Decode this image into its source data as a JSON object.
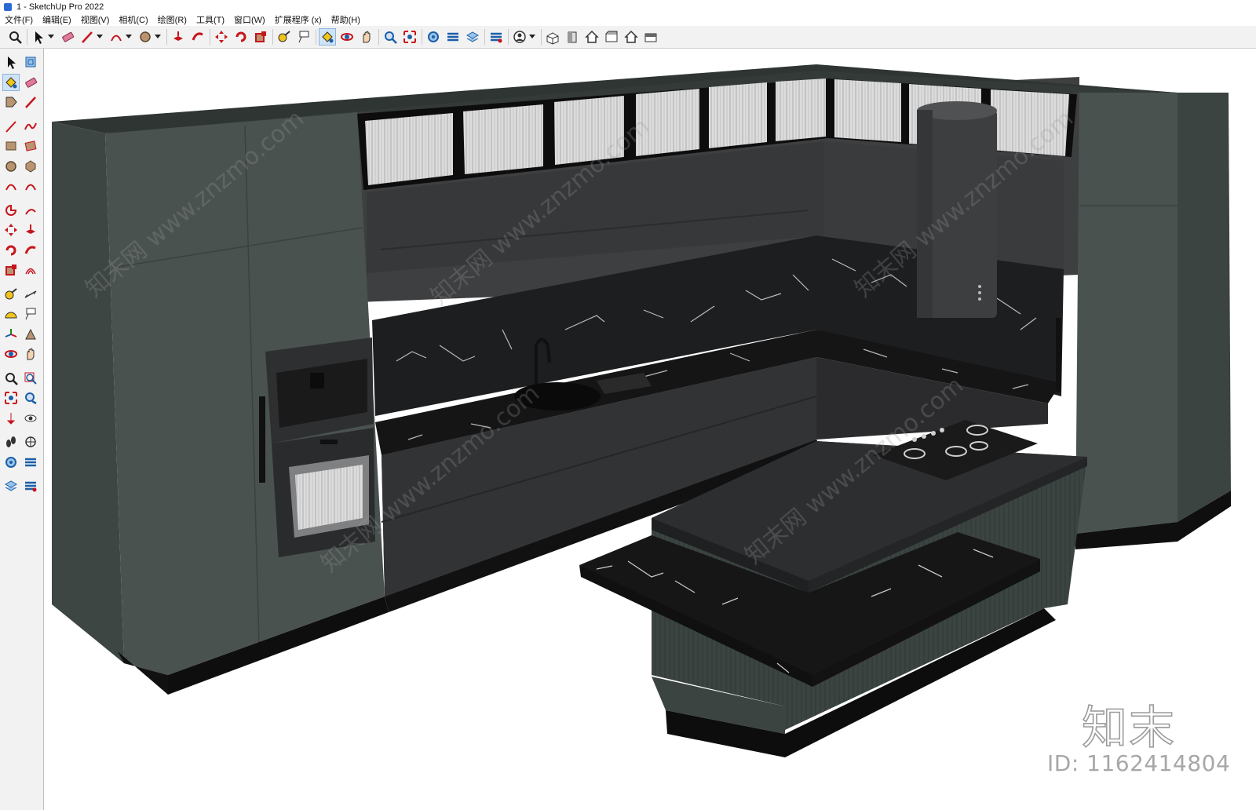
{
  "window": {
    "title": "1 - SketchUp Pro 2022"
  },
  "menu": [
    "文件(F)",
    "编辑(E)",
    "视图(V)",
    "相机(C)",
    "绘图(R)",
    "工具(T)",
    "窗口(W)",
    "扩展程序 (x)",
    "帮助(H)"
  ],
  "toolbar": {
    "icons": [
      "zoom-icon",
      "select-icon",
      "dropdown-arrow-icon",
      "eraser-icon",
      "pencil-line-icon",
      "dropdown-arrow-icon",
      "arc-icon",
      "dropdown-arrow-icon",
      "circle-icon",
      "dropdown-arrow-icon",
      "push-pull-icon",
      "follow-me-icon",
      "move-icon",
      "rotate-icon",
      "scale-icon",
      "tape-measure-icon",
      "text-label-icon",
      "paint-bucket-icon",
      "orbit-icon",
      "pan-icon",
      "zoom-tool-icon",
      "zoom-extents-icon",
      "outliner-icon",
      "tags-icon",
      "layers-icon",
      "styles-icon",
      "profile-icon",
      "dropdown-arrow-icon",
      "iso-view-icon",
      "front-view-icon",
      "home-view-icon",
      "right-view-icon",
      "back-view-icon",
      "left-view-icon"
    ],
    "active": "paint-bucket-icon"
  },
  "left_toolbar": {
    "icons": [
      "select-icon",
      "make-component-icon",
      "paint-bucket-icon",
      "eraser-icon",
      "tag-tool-icon",
      "pencil-icon",
      "line-icon",
      "freehand-icon",
      "rectangle-icon",
      "rotated-rectangle-icon",
      "circle-icon",
      "polygon-icon",
      "arc-icon",
      "two-point-arc-icon",
      "pie-icon",
      "three-point-arc-icon",
      "move-icon",
      "push-pull-icon",
      "rotate-icon",
      "follow-me-icon",
      "scale-icon",
      "offset-icon",
      "tape-measure-icon",
      "dimension-icon",
      "protractor-icon",
      "text-icon",
      "axes-icon",
      "3d-text-icon",
      "orbit-icon",
      "pan-icon",
      "zoom-icon",
      "zoom-window-icon",
      "zoom-extents-icon",
      "previous-view-icon",
      "position-camera-icon",
      "look-around-icon",
      "walk-icon",
      "section-plane-icon",
      "outliner-icon",
      "tags-icon",
      "layers-icon",
      "styles-icon"
    ],
    "active": "paint-bucket-icon"
  },
  "viewport": {
    "model": "kitchen-model",
    "wall_color": "#4a524f",
    "cabinet_color": "#3b3c3d",
    "countertop_color": "#1c1c1d",
    "watermarks": [
      "知末网 www.znzmo.com"
    ]
  },
  "branding": {
    "logo_text": "知末",
    "id_text": "ID: 1162414804"
  }
}
